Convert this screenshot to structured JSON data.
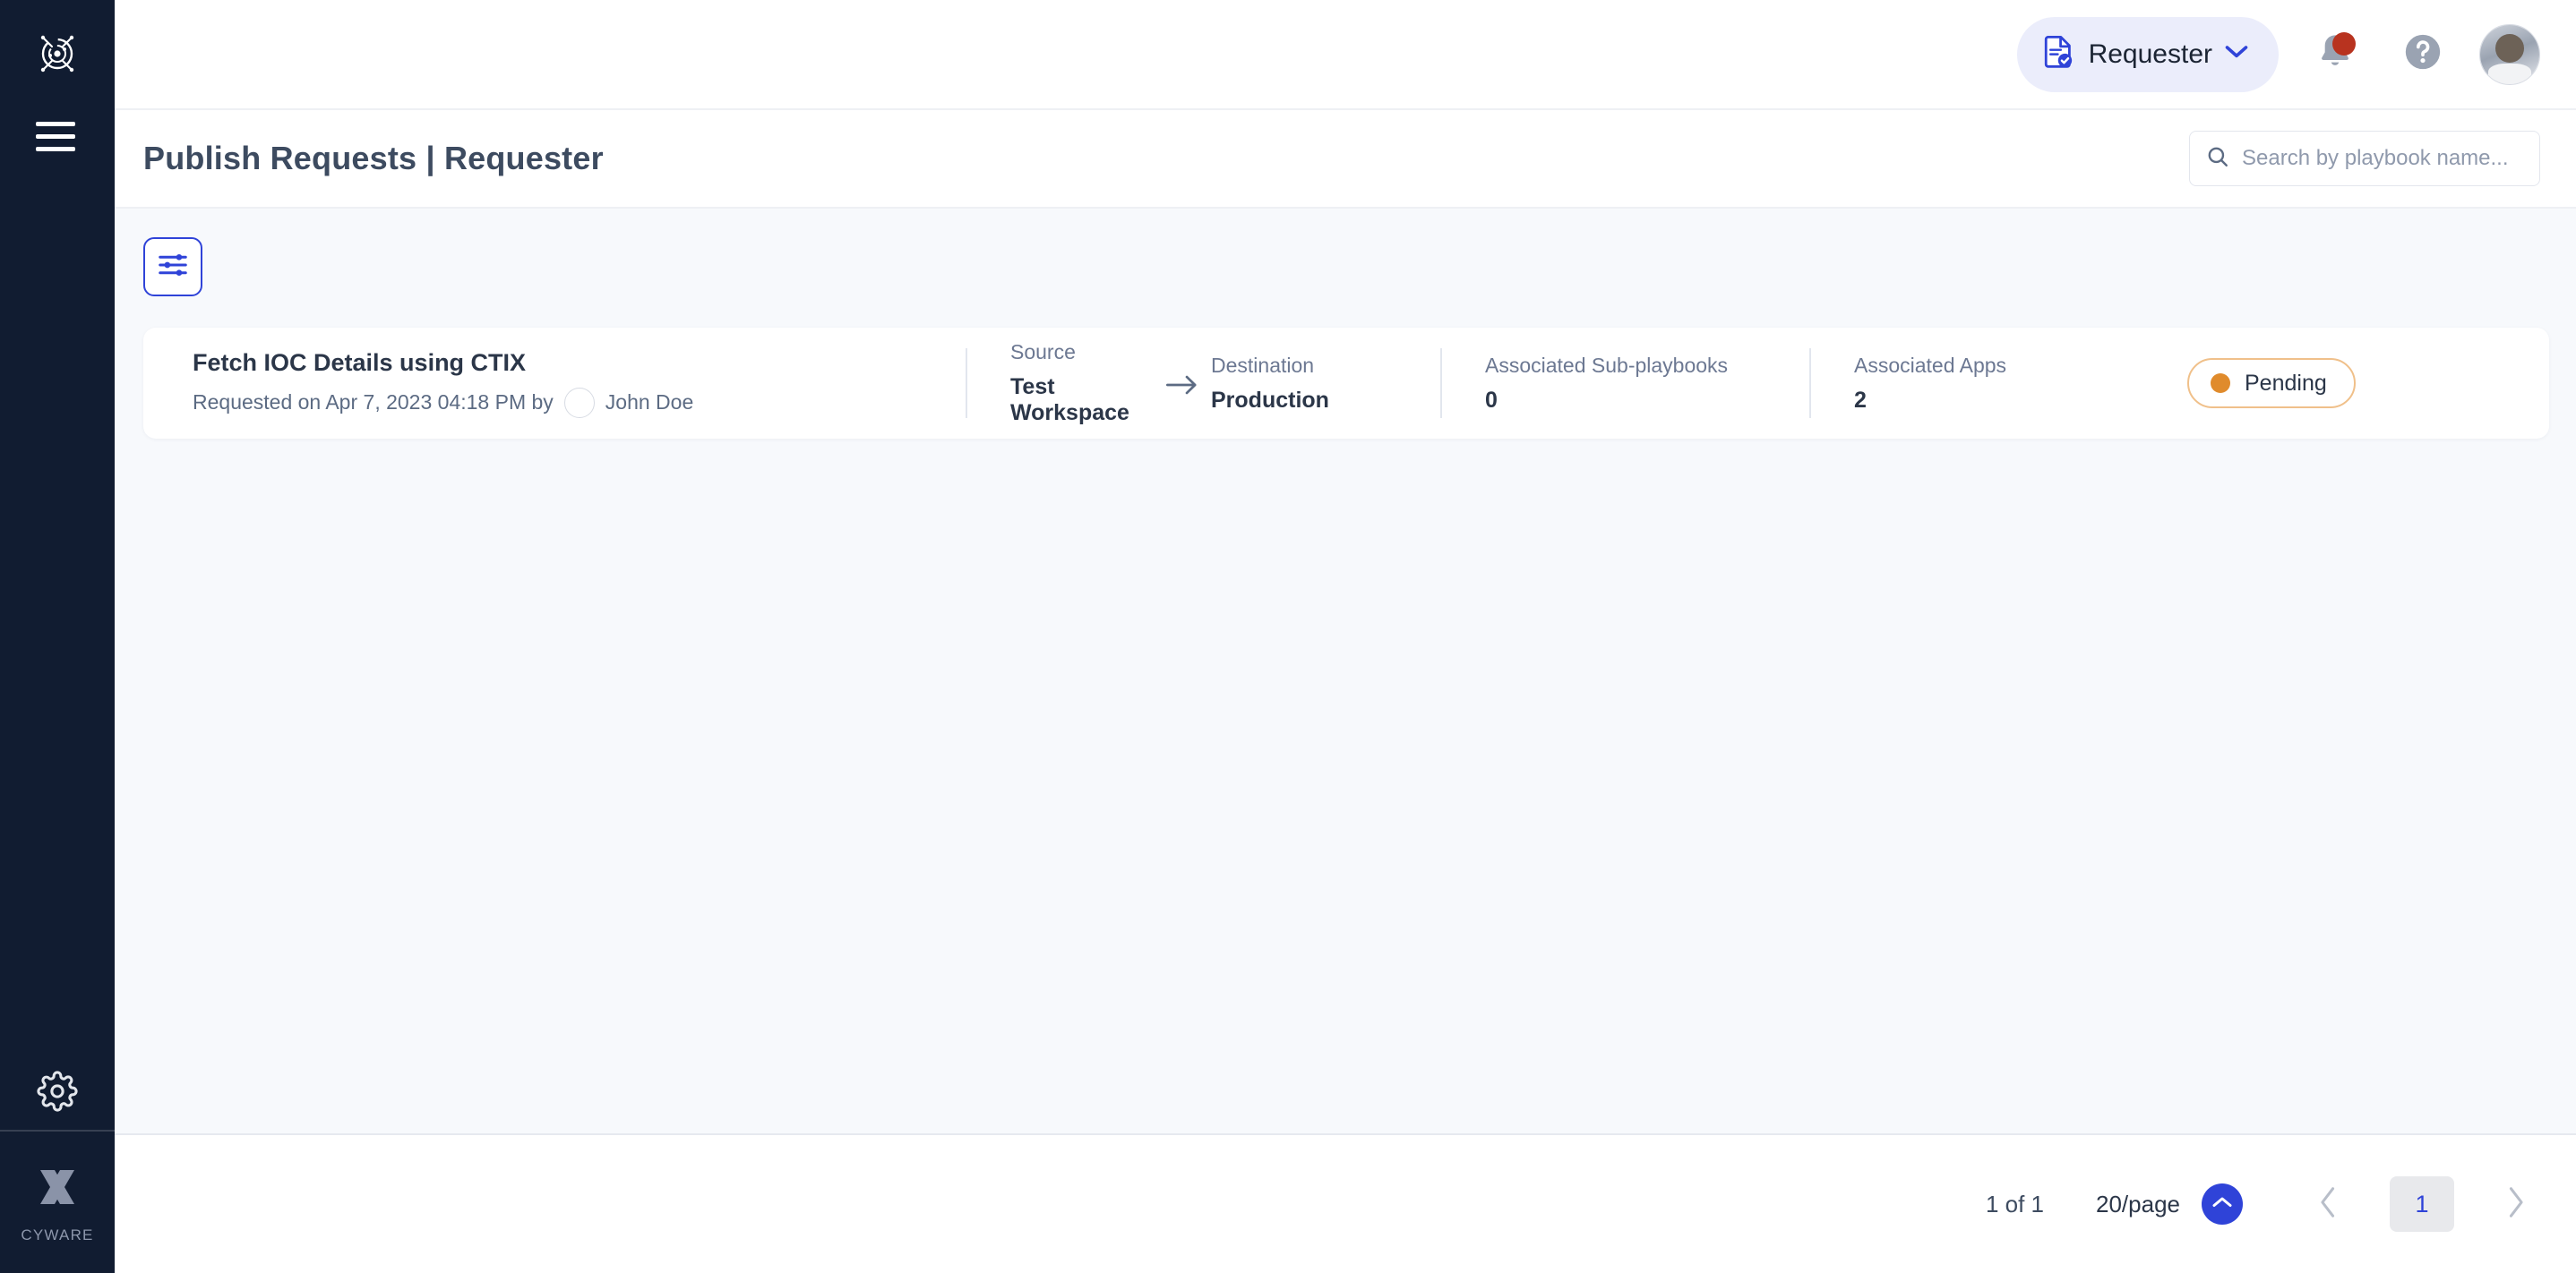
{
  "sidebar": {
    "logo_icon": "cyware-orb-logo-icon",
    "menu_icon": "hamburger-menu-icon",
    "settings_icon": "gear-icon",
    "brand_icon": "cyware-x-logo-icon",
    "brand_label": "CYWARE"
  },
  "header": {
    "role_pill": {
      "icon": "document-check-icon",
      "label": "Requester",
      "chevron_icon": "chevron-down-icon"
    },
    "notifications": {
      "icon": "bell-icon",
      "has_unread": true,
      "badge_color": "#B8331F"
    },
    "help": {
      "icon": "help-circle-icon"
    },
    "avatar": {
      "icon": "user-avatar"
    }
  },
  "titlebar": {
    "title": "Publish Requests | Requester",
    "search": {
      "icon": "search-icon",
      "value": "",
      "placeholder": "Search by playbook name..."
    }
  },
  "toolbar": {
    "filter_button": {
      "icon": "sliders-filter-icon",
      "label": "",
      "border_color": "#2F43D8"
    }
  },
  "list": {
    "columns": {
      "source": "Source",
      "destination": "Destination",
      "sub_playbooks": "Associated Sub-playbooks",
      "apps": "Associated Apps"
    },
    "rows": [
      {
        "name": "Fetch IOC Details using CTIX",
        "requested_prefix": "Requested on Apr 7, 2023 04:18 PM by",
        "requested_by": "John Doe",
        "requester_avatar": "user-avatar",
        "source": "Test Workspace",
        "arrow_icon": "arrow-right-icon",
        "destination": "Production",
        "sub_playbooks": "0",
        "apps": "2",
        "status": "Pending",
        "status_dot_color": "#E08B2C",
        "status_border_color": "#F0C08A"
      }
    ]
  },
  "pagination": {
    "total_label": "1 of 1",
    "page_size_label": "20/page",
    "page_size_toggle_icon": "chevron-up-icon",
    "prev_icon": "chevron-left-icon",
    "next_icon": "chevron-right-icon",
    "current_page": "1",
    "accent_color": "#2F43D8"
  }
}
